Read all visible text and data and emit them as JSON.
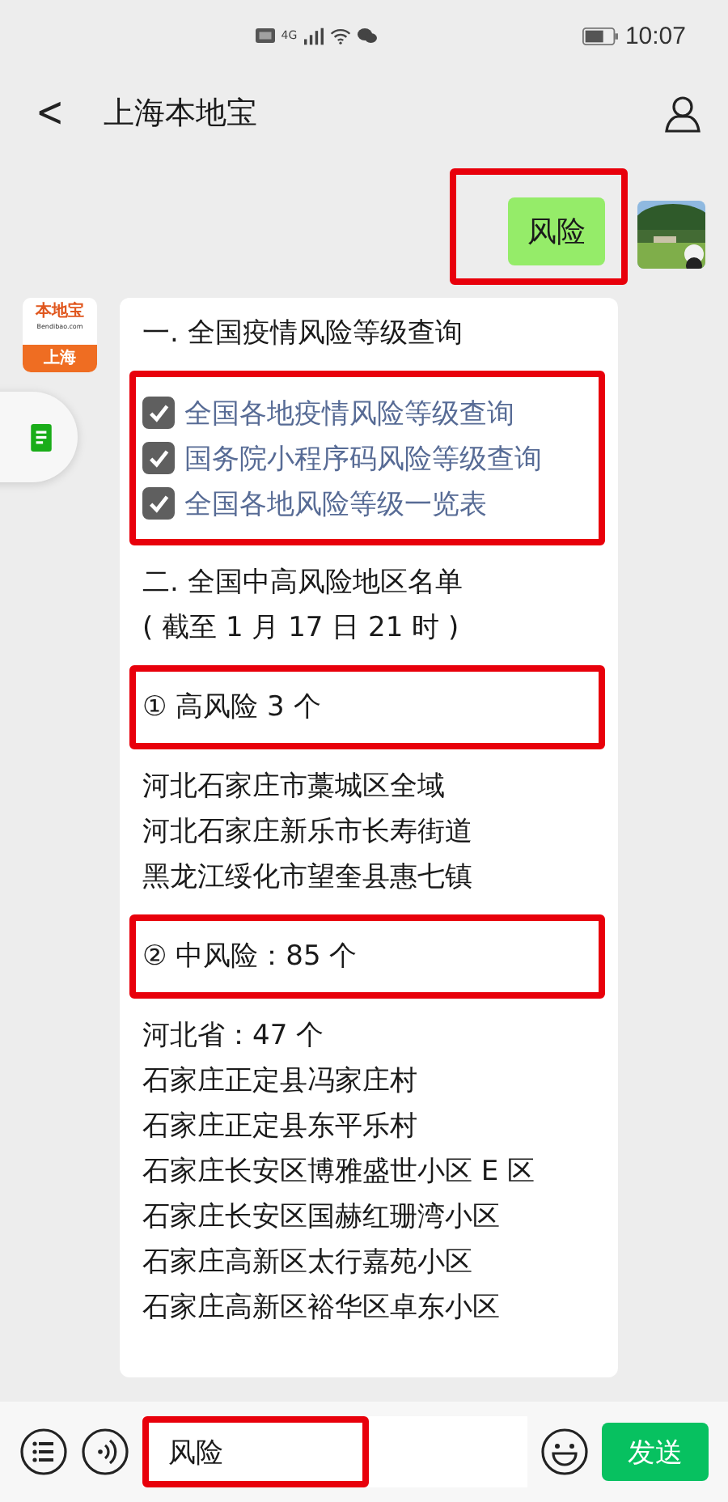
{
  "status_bar": {
    "network": "4G",
    "time": "10:07"
  },
  "header": {
    "back": "<",
    "title": "上海本地宝"
  },
  "messages": [
    {
      "kind": "outgoing",
      "text": "风险",
      "highlighted": true
    },
    {
      "kind": "card",
      "avatar": {
        "brand": "本地宝",
        "site": "Bendibao.com",
        "city": "上海"
      },
      "blocks": [
        {
          "kind": "text",
          "highlighted": false,
          "lines": [
            "一. 全国疫情风险等级查询"
          ]
        },
        {
          "kind": "links",
          "highlighted": true,
          "items": [
            {
              "text": "全国各地疫情风险等级查询",
              "checked": true
            },
            {
              "text": "国务院小程序码风险等级查询",
              "checked": true
            },
            {
              "text": "全国各地风险等级一览表",
              "checked": true
            }
          ]
        },
        {
          "kind": "text",
          "highlighted": false,
          "lines": [
            "二. 全国中高风险地区名单",
            "( 截至 1 月 17 日 21 时 )"
          ]
        },
        {
          "kind": "text",
          "highlighted": true,
          "lines": [
            "① 高风险 3 个"
          ]
        },
        {
          "kind": "text",
          "highlighted": false,
          "lines": [
            "河北石家庄市藁城区全域",
            "河北石家庄新乐市长寿街道",
            "黑龙江绥化市望奎县惠七镇"
          ]
        },
        {
          "kind": "text",
          "highlighted": true,
          "lines": [
            "② 中风险：85 个"
          ]
        },
        {
          "kind": "text",
          "highlighted": false,
          "lines": [
            "河北省：47 个",
            "石家庄正定县冯家庄村",
            "石家庄正定县东平乐村",
            "石家庄长安区博雅盛世小区 E 区",
            "石家庄长安区国赫红珊湾小区",
            "石家庄高新区太行嘉苑小区",
            "石家庄高新区裕华区卓东小区"
          ]
        }
      ]
    }
  ],
  "input_bar": {
    "value": "风险",
    "highlighted": true,
    "send": "发送"
  }
}
